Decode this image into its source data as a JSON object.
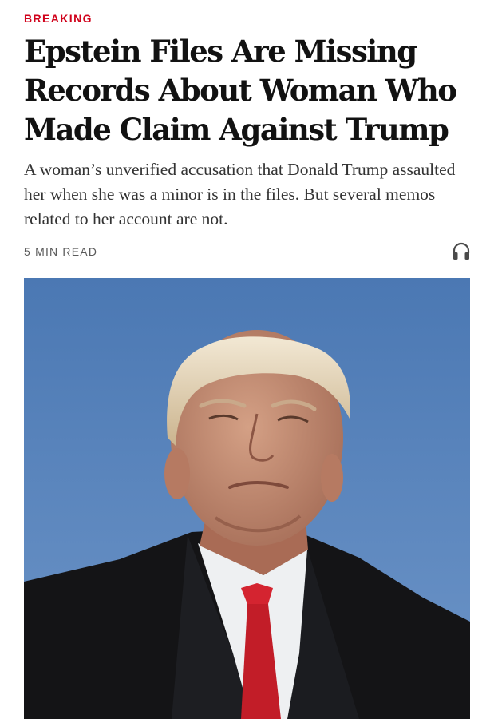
{
  "article": {
    "kicker": "BREAKING",
    "headline": "Epstein Files Are Missing Records About Woman Who Made Claim Against Trump",
    "summary": "A woman’s unverified accusation that Donald Trump assaulted her when she was a minor is in the files. But several memos related to her account are not.",
    "read_time": "5 MIN READ",
    "listen_icon": "headphones-icon",
    "image_icon": "portrait-photo"
  },
  "colors": {
    "kicker": "#d0021b",
    "headline": "#121212",
    "summary": "#333333",
    "meta": "#5a5a5a",
    "sky": "#5b85bd"
  }
}
